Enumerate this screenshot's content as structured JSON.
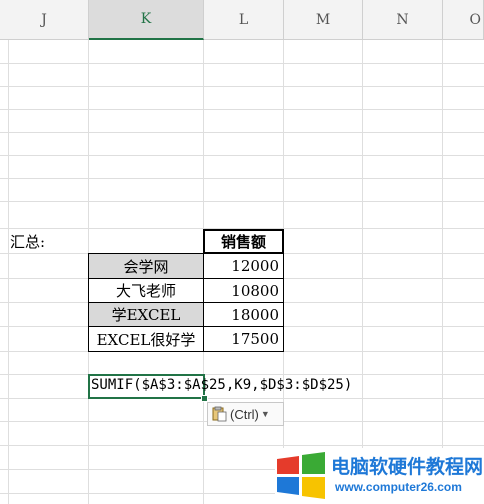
{
  "columns": [
    "J",
    "K",
    "L",
    "M",
    "N",
    "O"
  ],
  "summary_label": "汇总:",
  "table": {
    "header": "销售额",
    "rows": [
      {
        "name": "会学网",
        "value": "12000"
      },
      {
        "name": "大飞老师",
        "value": "10800"
      },
      {
        "name": "学EXCEL",
        "value": "18000"
      },
      {
        "name": "EXCEL很好学",
        "value": "17500"
      }
    ]
  },
  "formula_text": "SUMIF($A$3:$A$25,K9,$D$3:$D$25)",
  "paste_options_label": "(Ctrl)",
  "watermark": {
    "title": "电脑软硬件教程网",
    "url": "www.computer26.com"
  },
  "colors": {
    "selection": "#217346",
    "gray_cell": "#d9d9d9",
    "logo_red": "#e53b2b",
    "logo_green": "#3aaa35",
    "logo_blue": "#1e78d7",
    "logo_yellow": "#f7c300",
    "text_blue": "#1e78d7"
  }
}
